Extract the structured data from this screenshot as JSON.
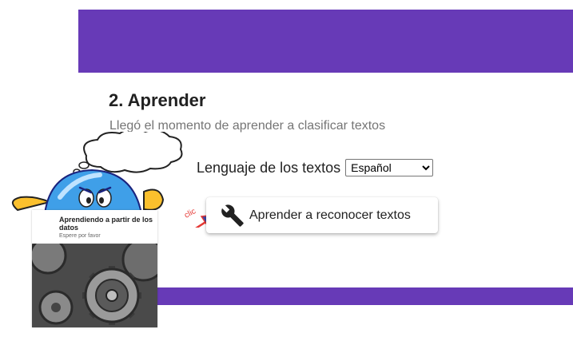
{
  "section": {
    "title": "2. Aprender",
    "subtitle": "Llegó el momento de aprender a clasificar textos"
  },
  "language": {
    "label": "Lenguaje de los textos",
    "selected": "Español",
    "options": [
      "Español"
    ]
  },
  "learn_button": {
    "label": "Aprender a reconocer textos",
    "icon": "wrench-icon"
  },
  "annotation": {
    "text": "clic"
  },
  "loading_card": {
    "title": "Aprendiendo a partir de los datos",
    "subtitle": "Espere por favor"
  },
  "colors": {
    "accent": "#673ab7",
    "arrow": "#e53935"
  }
}
